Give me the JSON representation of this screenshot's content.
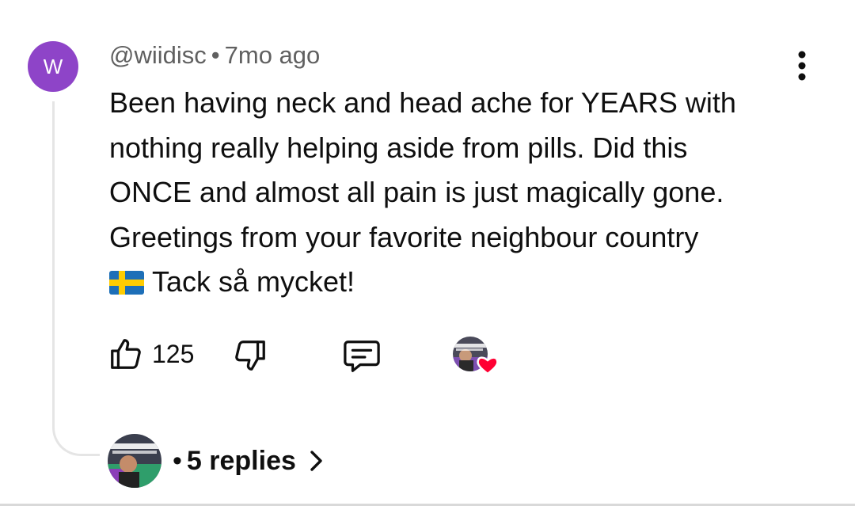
{
  "comment": {
    "avatar_letter": "W",
    "username": "@wiidisc",
    "separator": "•",
    "timestamp": "7mo ago",
    "lines": [
      "Been having neck and head ache for YEARS with",
      "nothing really helping aside from pills. Did this",
      "ONCE and almost all pain is just magically gone.",
      "Greetings from your favorite neighbour country",
      "Tack så mycket!"
    ],
    "flag_icon": "swedish-flag-emoji"
  },
  "actions": {
    "like_count": "125",
    "like_icon": "thumbs-up-icon",
    "dislike_icon": "thumbs-down-icon",
    "reply_icon": "comment-reply-icon",
    "creator_heart": true
  },
  "replies": {
    "separator": "•",
    "label": "5 replies"
  },
  "colors": {
    "avatar_bg": "#8e44c8",
    "text": "#0f0f0f",
    "meta": "#606060",
    "heart": "#ff0033",
    "thread_line": "#e5e5e5"
  }
}
